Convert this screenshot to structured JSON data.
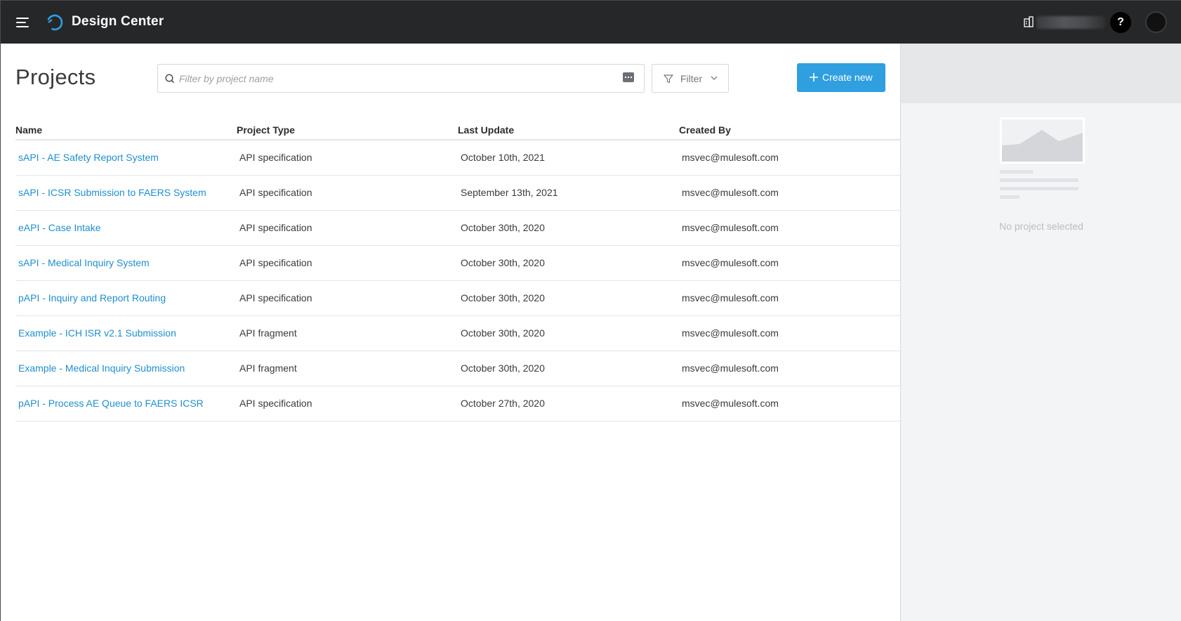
{
  "app": {
    "title": "Design Center",
    "help_label": "?"
  },
  "page": {
    "title": "Projects"
  },
  "search": {
    "placeholder": "Filter by project name"
  },
  "filter": {
    "label": "Filter"
  },
  "create": {
    "label": "Create new"
  },
  "table": {
    "headers": [
      "Name",
      "Project Type",
      "Last Update",
      "Created By"
    ],
    "rows": [
      {
        "name": "sAPI - AE Safety Report System",
        "type": "API specification",
        "updated": "October 10th, 2021",
        "created_by": "msvec@mulesoft.com"
      },
      {
        "name": "sAPI - ICSR Submission to FAERS System",
        "type": "API specification",
        "updated": "September 13th, 2021",
        "created_by": "msvec@mulesoft.com"
      },
      {
        "name": "eAPI - Case Intake",
        "type": "API specification",
        "updated": "October 30th, 2020",
        "created_by": "msvec@mulesoft.com"
      },
      {
        "name": "sAPI - Medical Inquiry System",
        "type": "API specification",
        "updated": "October 30th, 2020",
        "created_by": "msvec@mulesoft.com"
      },
      {
        "name": "pAPI - Inquiry and Report Routing",
        "type": "API specification",
        "updated": "October 30th, 2020",
        "created_by": "msvec@mulesoft.com"
      },
      {
        "name": "Example - ICH ISR v2.1 Submission",
        "type": "API fragment",
        "updated": "October 30th, 2020",
        "created_by": "msvec@mulesoft.com"
      },
      {
        "name": "Example - Medical Inquiry Submission",
        "type": "API fragment",
        "updated": "October 30th, 2020",
        "created_by": "msvec@mulesoft.com"
      },
      {
        "name": "pAPI - Process AE Queue to FAERS ICSR",
        "type": "API specification",
        "updated": "October 27th, 2020",
        "created_by": "msvec@mulesoft.com"
      }
    ]
  },
  "side_panel": {
    "empty_text": "No project selected"
  },
  "colors": {
    "topbar": "#262729",
    "accent": "#2f9fe0",
    "link": "#1f8fcf",
    "panel": "#f3f4f6"
  },
  "icons": {
    "menu": "hamburger-icon",
    "logo": "design-center-logo",
    "search": "search-icon",
    "keyboard": "keyboard-icon",
    "filter": "funnel-icon",
    "chevron": "chevron-down-icon",
    "plus": "plus-icon",
    "org": "building-icon"
  }
}
